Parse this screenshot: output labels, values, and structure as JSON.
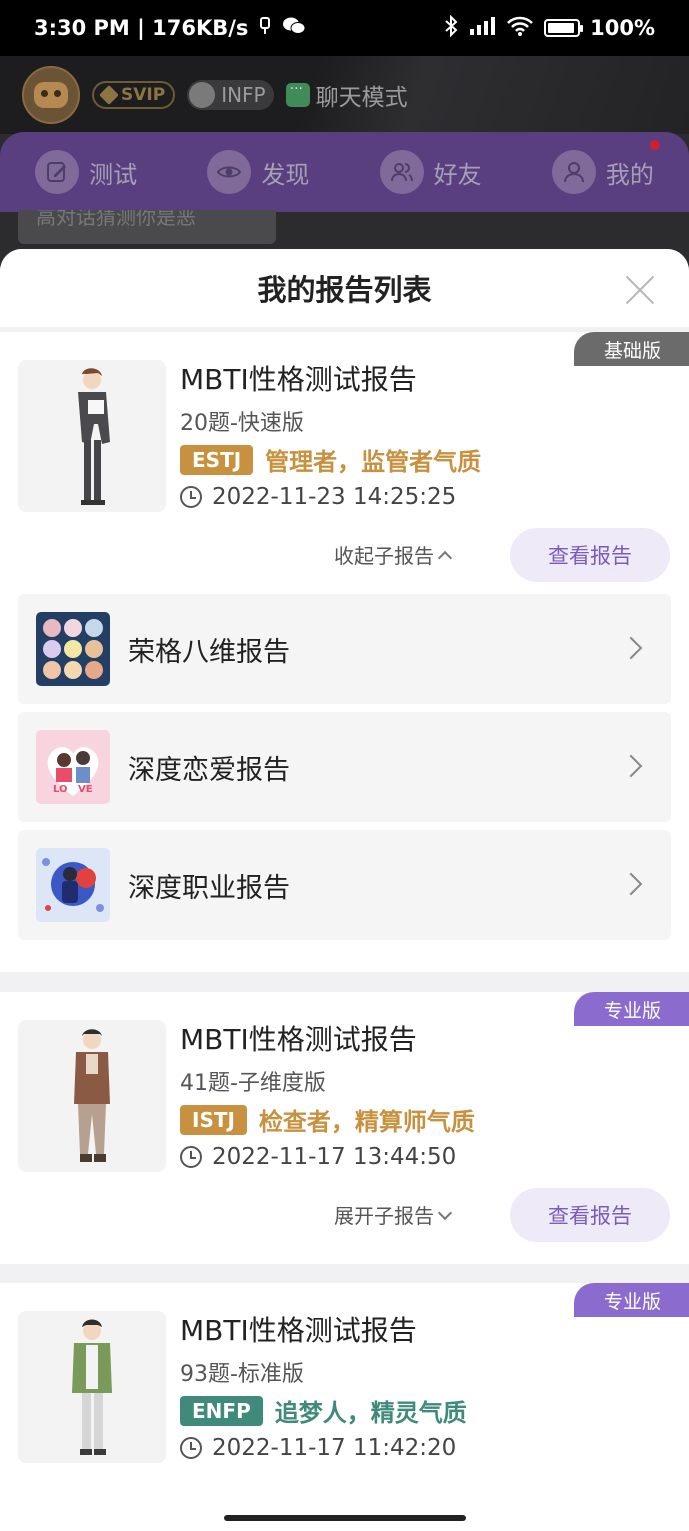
{
  "status_bar": {
    "time": "3:30 PM | 176KB/s",
    "battery": "100%"
  },
  "background_app": {
    "svip_label": "SVIP",
    "mbti_label": "INFP",
    "chat_mode_label": "聊天模式",
    "tabs": [
      {
        "label": "测试",
        "icon": "edit-icon"
      },
      {
        "label": "发现",
        "icon": "eye-icon"
      },
      {
        "label": "好友",
        "icon": "friends-icon"
      },
      {
        "label": "我的",
        "icon": "user-icon"
      }
    ],
    "behind_text": "高对话猜测你是恶"
  },
  "sheet": {
    "title": "我的报告列表"
  },
  "reports": [
    {
      "version": "基础版",
      "title": "MBTI性格测试报告",
      "subtitle": "20题-快速版",
      "type_code": "ESTJ",
      "type_desc": "管理者，监管者气质",
      "type_color": "#c8913f",
      "datetime": "2022-11-23 14:25:25",
      "toggle_label": "收起子报告",
      "view_label": "查看报告",
      "sub_reports": [
        {
          "label": "荣格八维报告",
          "icon": "jung-eight-icon"
        },
        {
          "label": "深度恋爱报告",
          "icon": "love-icon"
        },
        {
          "label": "深度职业报告",
          "icon": "career-icon"
        }
      ]
    },
    {
      "version": "专业版",
      "title": "MBTI性格测试报告",
      "subtitle": "41题-子维度版",
      "type_code": "ISTJ",
      "type_desc": "检查者，精算师气质",
      "type_color": "#c8913f",
      "datetime": "2022-11-17 13:44:50",
      "toggle_label": "展开子报告",
      "view_label": "查看报告"
    },
    {
      "version": "专业版",
      "title": "MBTI性格测试报告",
      "subtitle": "93题-标准版",
      "type_code": "ENFP",
      "type_desc": "追梦人，精灵气质",
      "type_color": "#3f8a7b",
      "datetime": "2022-11-17 11:42:20"
    }
  ]
}
